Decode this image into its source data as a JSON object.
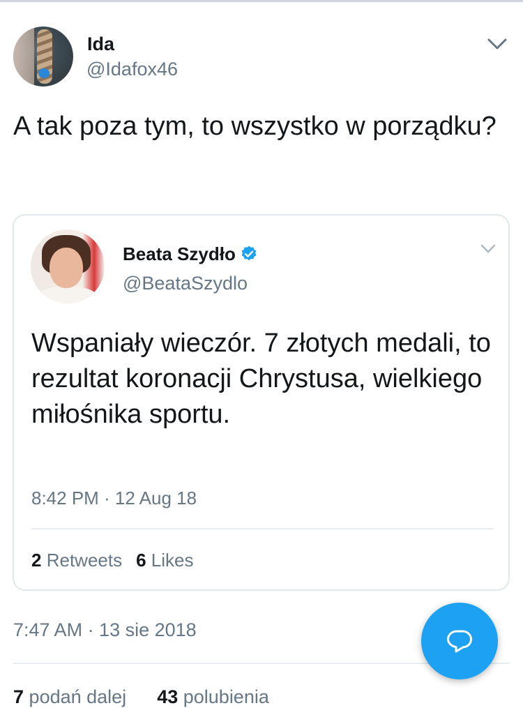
{
  "tweet": {
    "author_name": "Ida",
    "author_handle": "@Idafox46",
    "text": "A tak poza tym, to wszystko w porządku?",
    "timestamp": "7:47 AM · 13 sie 2018",
    "retweets_count": "7",
    "retweets_label": "podań dalej",
    "likes_count": "43",
    "likes_label": "polubienia"
  },
  "quoted_tweet": {
    "author_name": "Beata Szydło",
    "author_handle": "@BeataSzydlo",
    "text": "Wspaniały wieczór. 7 złotych medali, to rezultat koronacji Chrystusa, wielkiego miłośnika sportu.",
    "timestamp": "8:42 PM · 12 Aug 18",
    "retweets_count": "2",
    "retweets_label": "Retweets",
    "likes_count": "6",
    "likes_label": "Likes"
  },
  "icons": {
    "menu": "chevron-down-icon",
    "verified": "verified-badge-icon",
    "fab": "reply-bubble-icon"
  },
  "colors": {
    "accent": "#1da1f2",
    "secondary_text": "#657786",
    "primary_text": "#14171a",
    "border": "#e1e8ed"
  }
}
